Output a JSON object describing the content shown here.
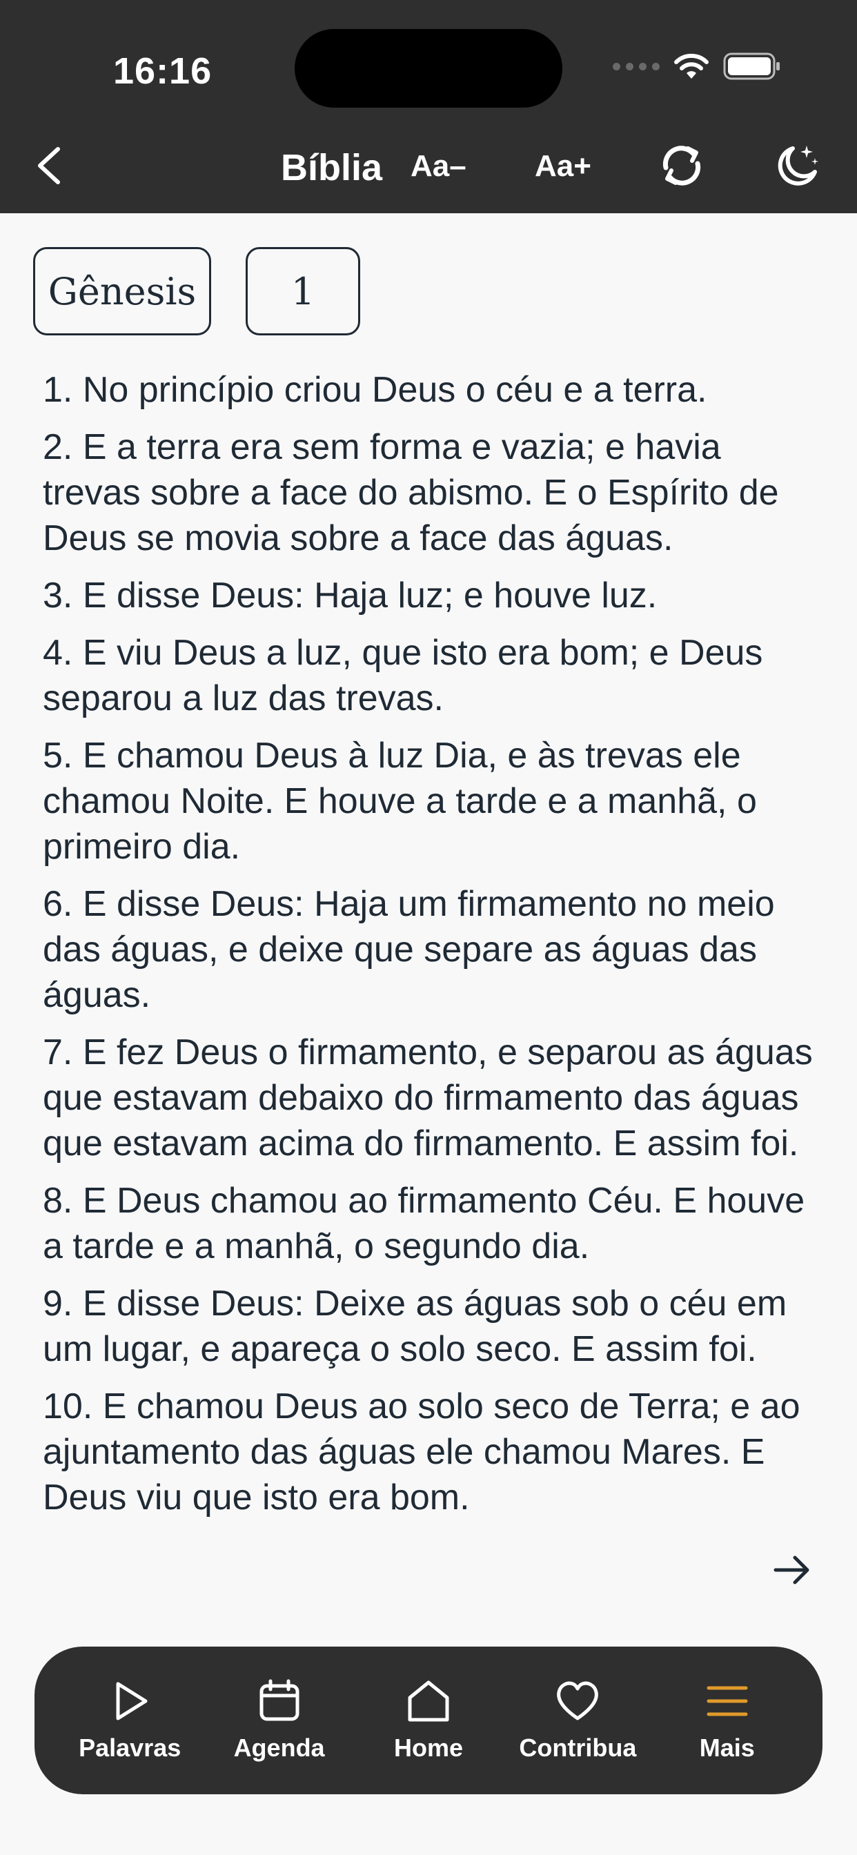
{
  "status_bar": {
    "time": "16:16"
  },
  "header": {
    "title": "Bíblia",
    "font_decrease": "Aa–",
    "font_increase": "Aa+"
  },
  "selectors": {
    "book": "Gênesis",
    "chapter": "1"
  },
  "verses": [
    "1. No princípio criou Deus o céu e a terra.",
    "2. E a terra era sem forma e vazia; e havia trevas sobre a face do abismo. E o Espírito de Deus se movia sobre a face das águas.",
    "3. E disse Deus: Haja luz; e houve luz.",
    "4. E viu Deus a luz, que isto era bom; e Deus separou a luz das trevas.",
    "5. E chamou Deus à luz Dia, e às trevas ele chamou Noite. E houve a tarde e a manhã, o primeiro dia.",
    "6. E disse Deus: Haja um firmamento no meio das águas, e deixe que separe as águas das águas.",
    "7. E fez Deus o firmamento, e separou as águas que estavam debaixo do firmamento das águas que estavam acima do firmamento. E assim foi.",
    "8. E Deus chamou ao firmamento Céu. E houve a tarde e a manhã, o segundo dia.",
    "9. E disse Deus: Deixe as águas sob o céu em um lugar, e apareça o solo seco. E assim foi.",
    "10. E chamou Deus ao solo seco de Terra; e ao ajuntamento das águas ele chamou Mares. E Deus viu que isto era bom."
  ],
  "tabs": [
    {
      "label": "Palavras",
      "icon": "play-icon"
    },
    {
      "label": "Agenda",
      "icon": "calendar-icon"
    },
    {
      "label": "Home",
      "icon": "home-icon"
    },
    {
      "label": "Contribua",
      "icon": "heart-icon"
    },
    {
      "label": "Mais",
      "icon": "menu-icon"
    }
  ],
  "colors": {
    "header_bg": "#2f2f2f",
    "active_tab": "#e09a2b",
    "text": "#1f2a35"
  }
}
